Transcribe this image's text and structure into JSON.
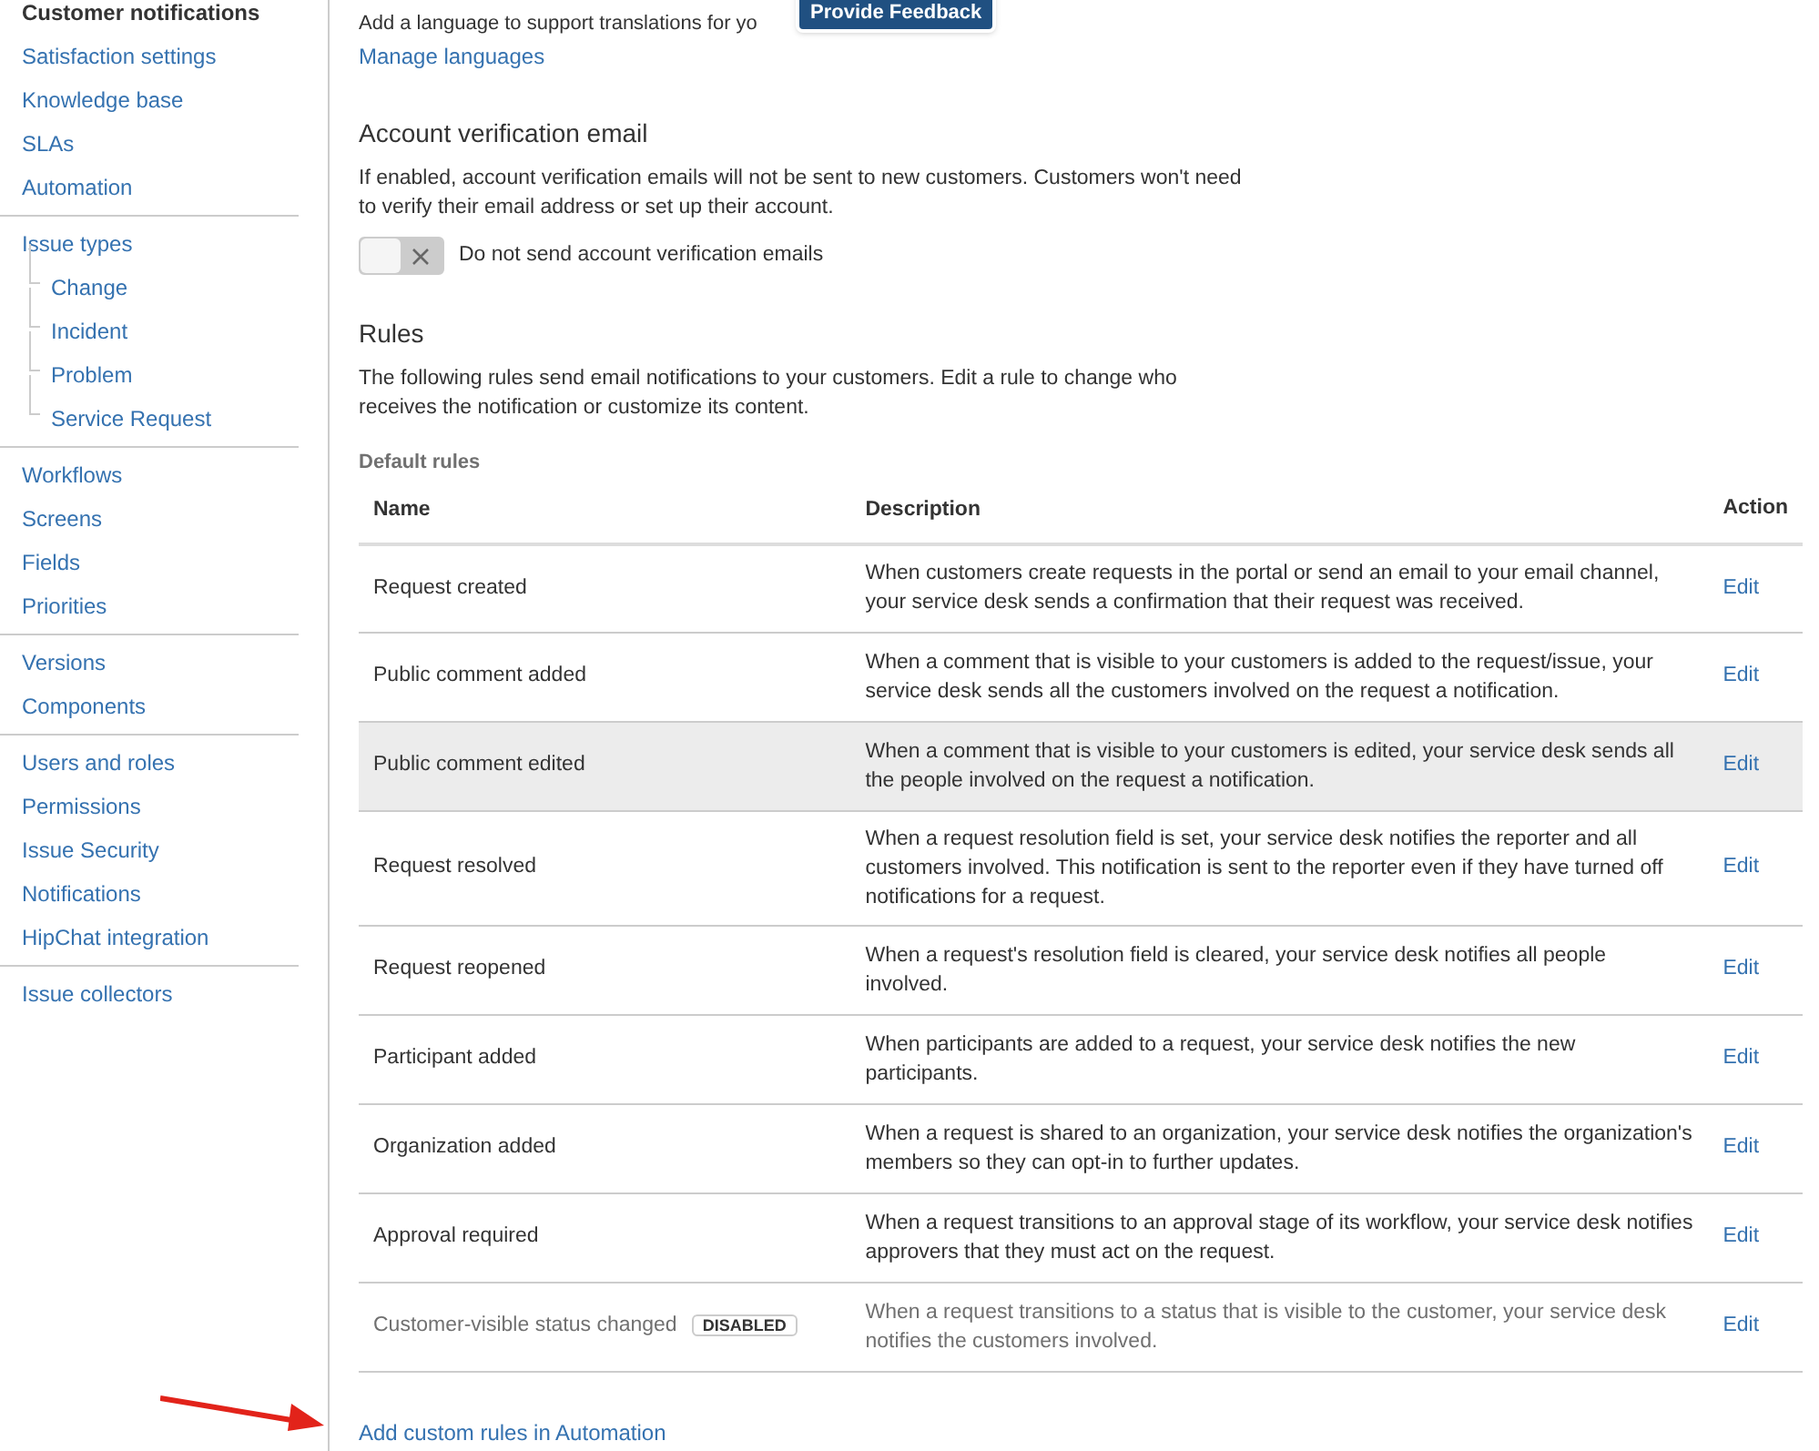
{
  "sidebar": {
    "groups": [
      {
        "items": [
          {
            "label": "Customer notifications",
            "selected": true
          },
          {
            "label": "Satisfaction settings",
            "selected": false
          },
          {
            "label": "Knowledge base",
            "selected": false
          },
          {
            "label": "SLAs",
            "selected": false
          },
          {
            "label": "Automation",
            "selected": false
          }
        ]
      },
      {
        "items": [
          {
            "label": "Issue types",
            "selected": false,
            "children": [
              {
                "label": "Change",
                "selected": false
              },
              {
                "label": "Incident",
                "selected": false
              },
              {
                "label": "Problem",
                "selected": false
              },
              {
                "label": "Service Request",
                "selected": false
              }
            ]
          }
        ]
      },
      {
        "items": [
          {
            "label": "Workflows",
            "selected": false
          },
          {
            "label": "Screens",
            "selected": false
          },
          {
            "label": "Fields",
            "selected": false
          },
          {
            "label": "Priorities",
            "selected": false
          }
        ]
      },
      {
        "items": [
          {
            "label": "Versions",
            "selected": false
          },
          {
            "label": "Components",
            "selected": false
          }
        ]
      },
      {
        "items": [
          {
            "label": "Users and roles",
            "selected": false
          },
          {
            "label": "Permissions",
            "selected": false
          },
          {
            "label": "Issue Security",
            "selected": false
          },
          {
            "label": "Notifications",
            "selected": false
          },
          {
            "label": "HipChat integration",
            "selected": false
          }
        ]
      },
      {
        "items": [
          {
            "label": "Issue collectors",
            "selected": false
          }
        ]
      }
    ]
  },
  "languages": {
    "intro": "Add a language to support translations for yo",
    "feedback_button": "Provide Feedback",
    "link": "Manage languages"
  },
  "verification": {
    "title": "Account verification email",
    "description": "If enabled, account verification emails will not be sent to new customers. Customers won't need to verify their email address or set up their account.",
    "toggle": {
      "label": "Do not send account verification emails",
      "on": false
    }
  },
  "rules": {
    "title": "Rules",
    "description": "The following rules send email notifications to your customers. Edit a rule to change who receives the notification or customize its content.",
    "subtitle": "Default rules",
    "table": {
      "columns": [
        "Name",
        "Description",
        "Action"
      ],
      "rows": [
        {
          "name": "Request created",
          "description": "When customers create requests in the portal or send an email to your email channel, your service desk sends a confirmation that their request was received.",
          "action": "Edit",
          "highlighted": false,
          "disabled": false
        },
        {
          "name": "Public comment added",
          "description": "When a comment that is visible to your customers is added to the request/issue, your service desk sends all the customers involved on the request a notification.",
          "action": "Edit",
          "highlighted": false,
          "disabled": false
        },
        {
          "name": "Public comment edited",
          "description": "When a comment that is visible to your customers is edited, your service desk sends all the people involved on the request a notification.",
          "action": "Edit",
          "highlighted": true,
          "disabled": false
        },
        {
          "name": "Request resolved",
          "description": "When a request resolution field is set, your service desk notifies the reporter and all customers involved. This notification is sent to the reporter even if they have turned off notifications for a request.",
          "action": "Edit",
          "highlighted": false,
          "disabled": false
        },
        {
          "name": "Request reopened",
          "description": "When a request's resolution field is cleared, your service desk notifies all people involved.",
          "action": "Edit",
          "highlighted": false,
          "disabled": false
        },
        {
          "name": "Participant added",
          "description": "When participants are added to a request, your service desk notifies the new participants.",
          "action": "Edit",
          "highlighted": false,
          "disabled": false
        },
        {
          "name": "Organization added",
          "description": "When a request is shared to an organization, your service desk notifies the organization's members so they can opt-in to further updates.",
          "action": "Edit",
          "highlighted": false,
          "disabled": false
        },
        {
          "name": "Approval required",
          "description": "When a request transitions to an approval stage of its workflow, your service desk notifies approvers that they must act on the request.",
          "action": "Edit",
          "highlighted": false,
          "disabled": false
        },
        {
          "name": "Customer-visible status changed",
          "badge": "DISABLED",
          "description": "When a request transitions to a status that is visible to the customer, your service desk notifies the customers involved.",
          "action": "Edit",
          "highlighted": false,
          "disabled": true
        }
      ]
    },
    "custom_link": "Add custom rules in Automation"
  }
}
